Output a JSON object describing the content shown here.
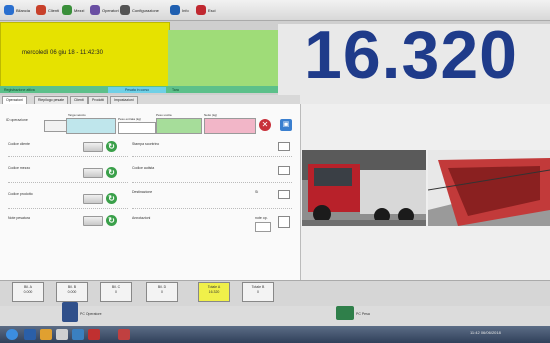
{
  "menu": {
    "items": [
      {
        "label": "Bilancia",
        "icon": "scale-icon",
        "color": "#2a6fcf"
      },
      {
        "label": "Clienti",
        "icon": "users-icon",
        "color": "#c8402a"
      },
      {
        "label": "Mezzi",
        "icon": "truck-icon",
        "color": "#3a8f3a"
      },
      {
        "label": "Operatori",
        "icon": "operator-icon",
        "color": "#6a4fa3"
      },
      {
        "label": "Configurazione",
        "icon": "wrench-icon",
        "color": "#555555"
      },
      {
        "label": "Info",
        "icon": "info-icon",
        "color": "#1f5fb0"
      },
      {
        "label": "Esci",
        "icon": "exit-icon",
        "color": "#c02830"
      }
    ]
  },
  "header": {
    "datetime": "mercoledì 06 giu 18 - 11:42:30",
    "weight": "16.320",
    "strip_left": "Registrazione attiva",
    "strip_button": "Pesata in corso",
    "strip_small": "Tara"
  },
  "tabs": [
    "Operazioni",
    "Riepilogo pesate",
    "Clienti",
    "Prodotti",
    "Impostazioni"
  ],
  "form": {
    "id_label": "ID operazione",
    "targa_label": "Targa veicolo",
    "peso_label": "Peso entrata (kg)",
    "peso_uscita_label": "Peso uscita",
    "netto_label": "Netto (kg)",
    "left_fields": [
      "Codice cliente",
      "Codice mezzo",
      "Codice prodotto",
      "Note pesatura"
    ],
    "right_fields": [
      "Stampa scontrino",
      "Codice autista",
      "Destinazione",
      "Annotazioni"
    ],
    "right_values": [
      "",
      "",
      "Sì",
      "note op."
    ]
  },
  "counters": [
    {
      "label": "Bil. A",
      "value": "0.000"
    },
    {
      "label": "Bil. B",
      "value": "0.000"
    },
    {
      "label": "Bil. C",
      "value": "0"
    },
    {
      "label": "Bil. D",
      "value": "0"
    },
    {
      "label": "Totale A",
      "value": "16.320"
    },
    {
      "label": "Totale B",
      "value": "0"
    }
  ],
  "bottom": {
    "left_caption": "PC Operatore",
    "right_caption": "PC Pesa"
  },
  "taskbar": {
    "clock": "11:42 06/06/2018"
  },
  "colors": {
    "weight": "#1f3b8a",
    "date_band": "#e6e200",
    "lime": "#9fdc78",
    "strip": "#5cc08a"
  }
}
